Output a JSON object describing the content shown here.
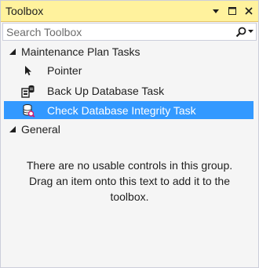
{
  "window": {
    "title": "Toolbox",
    "buttons": [
      "dropdown-arrow-icon",
      "maximize-icon",
      "close-icon"
    ]
  },
  "search": {
    "placeholder": "Search Toolbox",
    "icon": "search-icon"
  },
  "groups": [
    {
      "label": "Maintenance Plan Tasks",
      "expanded": true,
      "items": [
        {
          "label": "Pointer",
          "icon": "pointer-icon",
          "selected": false
        },
        {
          "label": "Back Up Database Task",
          "icon": "backup-database-icon",
          "selected": false
        },
        {
          "label": "Check Database Integrity Task",
          "icon": "check-database-icon",
          "selected": true
        }
      ]
    },
    {
      "label": "General",
      "expanded": true,
      "empty_message": "There are no usable controls in this group. Drag an item onto this text to add it to the toolbox."
    }
  ],
  "colors": {
    "title_bar": "#fff29d",
    "selection": "#3399ff",
    "background": "#f5f5f5"
  }
}
